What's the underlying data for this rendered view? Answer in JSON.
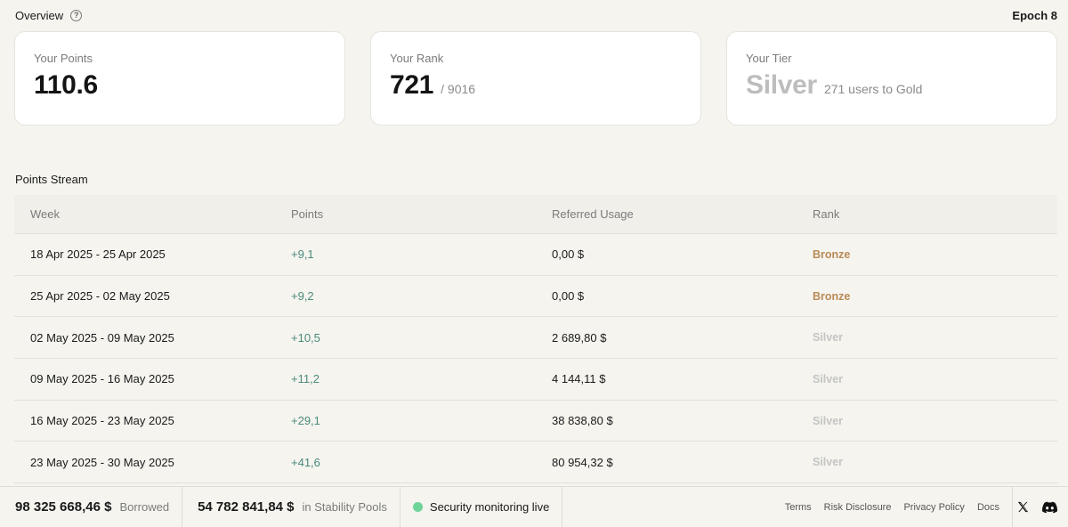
{
  "header": {
    "title": "Overview",
    "help_icon": "?",
    "epoch": "Epoch 8"
  },
  "cards": {
    "points": {
      "label": "Your Points",
      "value": "110.6"
    },
    "rank": {
      "label": "Your Rank",
      "value": "721",
      "sub": "/ 9016"
    },
    "tier": {
      "label": "Your Tier",
      "value": "Silver",
      "sub": "271 users to Gold"
    }
  },
  "stream": {
    "title": "Points Stream",
    "columns": [
      "Week",
      "Points",
      "Referred Usage",
      "Rank"
    ],
    "rows": [
      {
        "week": "18 Apr 2025 - 25 Apr 2025",
        "points": "+9,1",
        "usage": "0,00 $",
        "rank": "Bronze"
      },
      {
        "week": "25 Apr 2025 - 02 May 2025",
        "points": "+9,2",
        "usage": "0,00 $",
        "rank": "Bronze"
      },
      {
        "week": "02 May 2025 - 09 May 2025",
        "points": "+10,5",
        "usage": "2 689,80 $",
        "rank": "Silver"
      },
      {
        "week": "09 May 2025 - 16 May 2025",
        "points": "+11,2",
        "usage": "4 144,11 $",
        "rank": "Silver"
      },
      {
        "week": "16 May 2025 - 23 May 2025",
        "points": "+29,1",
        "usage": "38 838,80 $",
        "rank": "Silver"
      },
      {
        "week": "23 May 2025 - 30 May 2025",
        "points": "+41,6",
        "usage": "80 954,32 $",
        "rank": "Silver"
      }
    ]
  },
  "footer": {
    "borrowed_value": "98 325 668,46 $",
    "borrowed_label": "Borrowed",
    "pools_value": "54 782 841,84 $",
    "pools_label": "in Stability Pools",
    "security_text": "Security monitoring live",
    "links": [
      "Terms",
      "Risk Disclosure",
      "Privacy Policy",
      "Docs"
    ],
    "colors": {
      "bronze": "#b98a55",
      "silver": "#c4c4c4",
      "points": "#4a8a7c",
      "live": "#6fd49a"
    }
  }
}
